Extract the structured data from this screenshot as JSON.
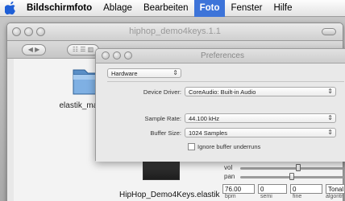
{
  "menubar": {
    "app_name": "Bildschirmfoto",
    "items": [
      "Ablage",
      "Bearbeiten",
      "Foto",
      "Fenster",
      "Hilfe"
    ]
  },
  "back_window": {
    "title": "hiphop_demo4keys.1.1",
    "nav_label": "◀ ▶",
    "view_label": "☷ ☰ ▥",
    "folder_label": "elastik_mac1.0.1"
  },
  "app_window": {
    "label": "HipHop_Demo4Keys.elastik",
    "mixer": {
      "vol_label": "vol",
      "pan_label": "pan",
      "vol_level": 0.56,
      "pan_level": 0.5
    },
    "fields": [
      {
        "value": "76.00",
        "label": "bpm"
      },
      {
        "value": "0",
        "label": "semi"
      },
      {
        "value": "0",
        "label": "fine"
      },
      {
        "value": "Tonal",
        "label": "algoritr"
      }
    ]
  },
  "preferences": {
    "title": "Preferences",
    "section": "Hardware",
    "device_driver_label": "Device Driver:",
    "device_driver_value": "CoreAudio: Built-in Audio",
    "sample_rate_label": "Sample Rate:",
    "sample_rate_value": "44.100 kHz",
    "buffer_size_label": "Buffer Size:",
    "buffer_size_value": "1024 Samples",
    "ignore_underruns_label": "Ignore buffer underruns",
    "ignore_underruns_checked": false
  }
}
